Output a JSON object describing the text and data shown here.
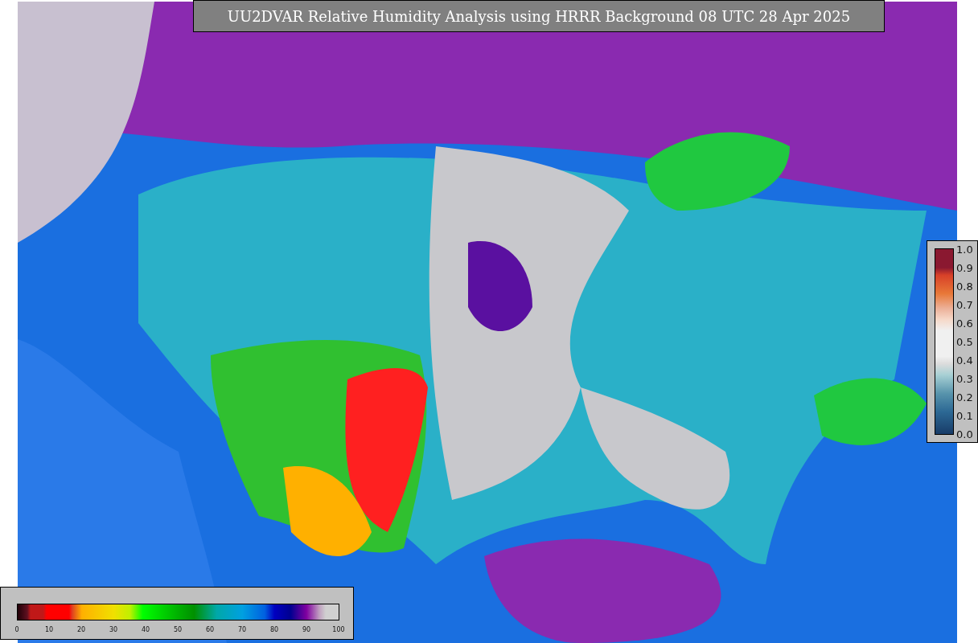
{
  "title": "UU2DVAR Relative Humidity Analysis using HRRR Background 08 UTC 28 Apr 2025",
  "humidity_colorbar": {
    "ticks": [
      "0",
      "10",
      "20",
      "30",
      "40",
      "50",
      "60",
      "70",
      "80",
      "90",
      "100"
    ]
  },
  "weight_colorbar": {
    "ticks": [
      "1.0",
      "0.9",
      "0.8",
      "0.7",
      "0.6",
      "0.5",
      "0.4",
      "0.3",
      "0.2",
      "0.1",
      "0.0"
    ]
  }
}
